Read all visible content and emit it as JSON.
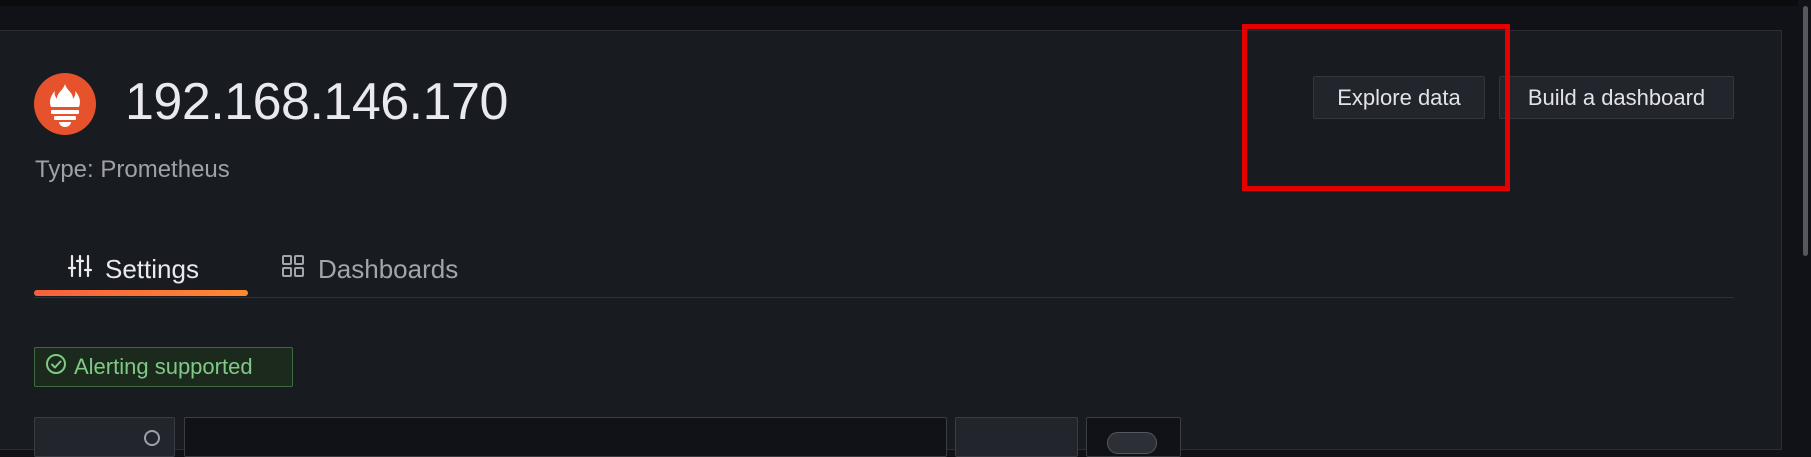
{
  "datasource": {
    "name": "192.168.146.170",
    "type_label": "Type: Prometheus",
    "logo_icon": "prometheus-flame-icon",
    "brand_color": "#e6522c"
  },
  "actions": {
    "explore_label": "Explore data",
    "build_label": "Build a dashboard"
  },
  "tabs": [
    {
      "label": "Settings",
      "icon": "sliders-icon",
      "active": true
    },
    {
      "label": "Dashboards",
      "icon": "grid-icon",
      "active": false
    }
  ],
  "badge": {
    "label": "Alerting supported",
    "icon": "check-circle-icon",
    "color": "#7fca86"
  },
  "colors": {
    "accent": "#f55f3e",
    "highlight_box": "#e50000",
    "background": "#111217",
    "panel": "#181b1f"
  }
}
